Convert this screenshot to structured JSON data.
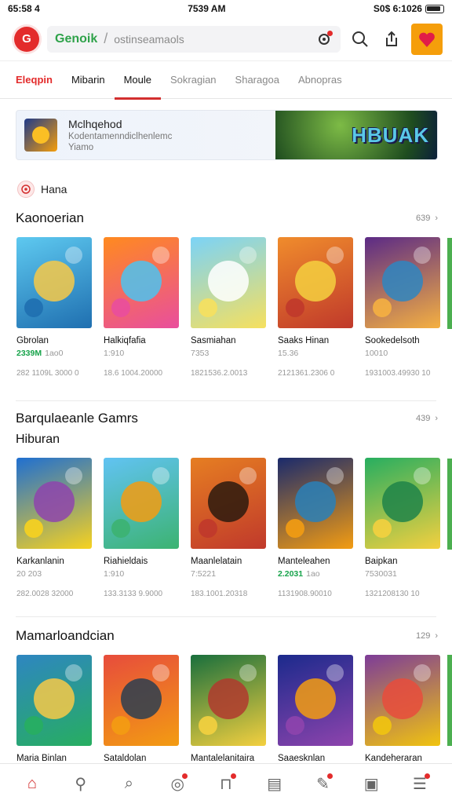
{
  "status": {
    "left": "65:58 4",
    "center": "7539 AM",
    "right": "S0$ 6:1026"
  },
  "header": {
    "brand": "Genoik",
    "placeholder": "ostinseamaols",
    "logo": "G"
  },
  "tabs": [
    "Eleqpin",
    "Mibarin",
    "Moule",
    "Sokragian",
    "Sharagoa",
    "Abnopras"
  ],
  "banner": {
    "title": "Mclhqehod",
    "subtitle": "Kodentamenndiclhenlemc",
    "line3": "Yiamo",
    "ad_text": "HBUAK"
  },
  "chip": {
    "label": "Hana",
    "icon": "target-icon"
  },
  "sections": [
    {
      "title": "Kaonoerian",
      "more": "639",
      "items": [
        {
          "title": "Gbrolan",
          "meta1": "2339M",
          "meta2": "1ao0",
          "extra": "282 1109L 3000 0",
          "colors": [
            "#5ec9f0",
            "#1f6fb0",
            "#f7c948"
          ]
        },
        {
          "title": "Halkiqfafia",
          "meta1": "",
          "meta2": "1:910",
          "extra": "18.6 1004.20000",
          "colors": [
            "#ff8a1f",
            "#e94e9d",
            "#4cc3f0"
          ]
        },
        {
          "title": "Sasmiahan",
          "meta1": "",
          "meta2": "7353",
          "extra": "1821536.2.0013",
          "colors": [
            "#7bd3f7",
            "#f6e05e",
            "#ffffff"
          ]
        },
        {
          "title": "Saaks Hinan",
          "meta1": "",
          "meta2": "15.36",
          "extra": "2121361.2306 0",
          "colors": [
            "#f08c2c",
            "#c0392b",
            "#f4d03f"
          ]
        },
        {
          "title": "Sookedelsoth",
          "meta1": "",
          "meta2": "10010",
          "extra": "1931003.49930 10",
          "colors": [
            "#5b2a86",
            "#f5b041",
            "#2e86c1"
          ]
        }
      ]
    },
    {
      "title": "Barqulaeanle Gamrs",
      "subtitle": "Hiburan",
      "more": "439",
      "items": [
        {
          "title": "Karkanlanin",
          "meta1": "",
          "meta2": "20 203",
          "extra": "282.0028 32000",
          "colors": [
            "#1f6fd1",
            "#f7d21f",
            "#8e44ad"
          ]
        },
        {
          "title": "Riahieldais",
          "meta1": "",
          "meta2": "1:910",
          "extra": "133.3133 9.9000",
          "colors": [
            "#61c3f3",
            "#3cb371",
            "#f39c12"
          ]
        },
        {
          "title": "Maanlelatain",
          "meta1": "",
          "meta2": "7:5221",
          "extra": "183.1001.20318",
          "colors": [
            "#e67e22",
            "#c0392b",
            "#2c1a0e"
          ]
        },
        {
          "title": "Manteleahen",
          "meta1": "2.2031",
          "meta2": "1ao",
          "extra": "1131908.90010",
          "colors": [
            "#1a2a6c",
            "#f39c12",
            "#2980b9"
          ]
        },
        {
          "title": "Baipkan",
          "meta1": "",
          "meta2": "7530031",
          "extra": "1321208130 10",
          "colors": [
            "#27ae60",
            "#f4d03f",
            "#1e8449"
          ]
        }
      ]
    },
    {
      "title": "Mamarloandcian",
      "more": "129",
      "items": [
        {
          "title": "Maria Binlan",
          "colors": [
            "#2e86c1",
            "#27ae60",
            "#f7c948"
          ]
        },
        {
          "title": "Sataldolan",
          "colors": [
            "#e74c3c",
            "#f39c12",
            "#2c3e50"
          ]
        },
        {
          "title": "Mantalelanitaira",
          "colors": [
            "#196f3d",
            "#f4d03f",
            "#b03a2e"
          ]
        },
        {
          "title": "Saaesknlan",
          "colors": [
            "#1b2a8c",
            "#8e44ad",
            "#f39c12"
          ]
        },
        {
          "title": "Kandeheraran",
          "colors": [
            "#7d3c98",
            "#f1c40f",
            "#e74c3c"
          ]
        }
      ]
    }
  ],
  "bottom_nav": [
    {
      "name": "home",
      "icon": "⌂",
      "active": true,
      "badge": false
    },
    {
      "name": "search-alt",
      "icon": "⚲",
      "active": false,
      "badge": false
    },
    {
      "name": "search",
      "icon": "⌕",
      "active": false,
      "badge": false
    },
    {
      "name": "games",
      "icon": "◎",
      "active": false,
      "badge": true
    },
    {
      "name": "bag",
      "icon": "⊓",
      "active": false,
      "badge": true
    },
    {
      "name": "news",
      "icon": "▤",
      "active": false,
      "badge": false
    },
    {
      "name": "edit",
      "icon": "✎",
      "active": false,
      "badge": true
    },
    {
      "name": "library",
      "icon": "▣",
      "active": false,
      "badge": false
    },
    {
      "name": "menu",
      "icon": "☰",
      "active": false,
      "badge": true
    }
  ]
}
